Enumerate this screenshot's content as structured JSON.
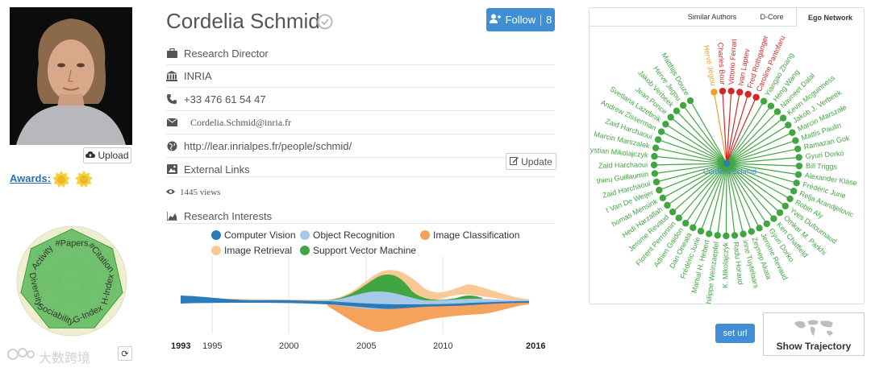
{
  "profile": {
    "name": "Cordelia Schmid",
    "upload_label": "Upload",
    "awards_label": "Awards:",
    "follow_label": "Follow",
    "follow_count": "8",
    "position": "Research Director",
    "affiliation": "INRIA",
    "phone": "+33 476 61 54 47",
    "email": "Cordelia.Schmid@inria.fr",
    "homepage": "http://lear.inrialpes.fr/people/schmid/",
    "external_links_label": "External Links",
    "update_label": "Update",
    "views": "1445 views",
    "research_interests_label": "Research Interests",
    "refresh_icon": "refresh-icon"
  },
  "radar": {
    "axes": [
      "#Papers",
      "#Citation",
      "H-Index",
      "G-Index",
      "Sociability",
      "Diversity",
      "Activity"
    ],
    "values": [
      0.95,
      0.95,
      0.95,
      0.95,
      0.95,
      0.95,
      0.95
    ],
    "fill": "#5cb85c"
  },
  "chart_data": {
    "type": "area",
    "title": "",
    "series": [
      {
        "name": "Computer Vision",
        "color": "#2b7bb9"
      },
      {
        "name": "Object Recognition",
        "color": "#a8c8e8"
      },
      {
        "name": "Image Classification",
        "color": "#f5a25d"
      },
      {
        "name": "Image Retrieval",
        "color": "#f9c995"
      },
      {
        "name": "Support Vector Machine",
        "color": "#41a541"
      }
    ],
    "x_start": "1993",
    "x_end": "2016",
    "xticks": [
      "1995",
      "2000",
      "2005",
      "2010"
    ],
    "grid": true
  },
  "ego": {
    "tabs": [
      "Similar Authors",
      "D-Core",
      "Ego Network"
    ],
    "active_tab": "Ego Network",
    "center": "Cordelia Schmid",
    "nodes": [
      {
        "name": "Hervé Jégou",
        "color": "#f0a030"
      },
      {
        "name": "Charles Bour",
        "color": "#d62728"
      },
      {
        "name": "Vittorio Ferrari",
        "color": "#d62728"
      },
      {
        "name": "Ivan Laptev",
        "color": "#d62728"
      },
      {
        "name": "Fred Rothganger",
        "color": "#d62728"
      },
      {
        "name": "Caroline Pantofaru",
        "color": "#d62728"
      },
      {
        "name": "Yiangao Zhang",
        "color": "#41a541"
      },
      {
        "name": "Heng Wang",
        "color": "#41a541"
      },
      {
        "name": "Navneet Dalal",
        "color": "#41a541"
      },
      {
        "name": "Kevin Mcguinness",
        "color": "#41a541"
      },
      {
        "name": "Jakob J. Verbeek",
        "color": "#41a541"
      },
      {
        "name": "Marcin Marszałe",
        "color": "#41a541"
      },
      {
        "name": "Mattis Paulin",
        "color": "#41a541"
      },
      {
        "name": "Ramazan Gok",
        "color": "#41a541"
      },
      {
        "name": "Gyuri Dorkó",
        "color": "#41a541"
      },
      {
        "name": "Bill Triggs",
        "color": "#41a541"
      },
      {
        "name": "Alexander Kläse",
        "color": "#41a541"
      },
      {
        "name": "Frédéric Jurie",
        "color": "#41a541"
      },
      {
        "name": "Relja Arandjelovic",
        "color": "#41a541"
      },
      {
        "name": "Robin Aly",
        "color": "#41a541"
      },
      {
        "name": "Yves Dufournaud",
        "color": "#41a541"
      },
      {
        "name": "Omkar M. Parkhi",
        "color": "#41a541"
      },
      {
        "name": "Ken Chatfield",
        "color": "#41a541"
      },
      {
        "name": "Gyuri Dorko",
        "color": "#41a541"
      },
      {
        "name": "Jerome Revaud",
        "color": "#41a541"
      },
      {
        "name": "Zeynep Akata",
        "color": "#41a541"
      },
      {
        "name": "inne Tuytelaars",
        "color": "#41a541"
      },
      {
        "name": "Radu Horaud",
        "color": "#41a541"
      },
      {
        "name": "K. Mikolajczyk",
        "color": "#41a541"
      },
      {
        "name": "hilippe Weinzaepfel",
        "color": "#41a541"
      },
      {
        "name": "Martial H. Hebert",
        "color": "#41a541"
      },
      {
        "name": "Frédéric Jurie",
        "color": "#41a541"
      },
      {
        "name": "Dan Oneata",
        "color": "#41a541"
      },
      {
        "name": "Adrien Gaidon",
        "color": "#41a541"
      },
      {
        "name": "Florent Perronnin",
        "color": "#41a541"
      },
      {
        "name": "Jerome Revaud",
        "color": "#41a541"
      },
      {
        "name": "Hedi Harzallah",
        "color": "#41a541"
      },
      {
        "name": "homas Mensink",
        "color": "#41a541"
      },
      {
        "name": "t Van De Weijer",
        "color": "#41a541"
      },
      {
        "name": "Zaid Harchaoui",
        "color": "#41a541"
      },
      {
        "name": "thieu Guillaumin",
        "color": "#41a541"
      },
      {
        "name": "Zaid Harchaoui",
        "color": "#41a541"
      },
      {
        "name": "ystian Mikolajczyk",
        "color": "#41a541"
      },
      {
        "name": "Marcin Marszalek",
        "color": "#41a541"
      },
      {
        "name": "Zaid Harchaoui",
        "color": "#41a541"
      },
      {
        "name": "Andrew Zisserman",
        "color": "#41a541"
      },
      {
        "name": "Svetlana Lazebnik",
        "color": "#41a541"
      },
      {
        "name": "Jean Ponce",
        "color": "#41a541"
      },
      {
        "name": "Jakob Verbeek",
        "color": "#41a541"
      },
      {
        "name": "Herve Jegou",
        "color": "#41a541"
      },
      {
        "name": "Matthijs Douze",
        "color": "#41a541"
      }
    ]
  },
  "actions": {
    "set_url_label": "set url",
    "show_trajectory_label": "Show Trajectory"
  },
  "watermark": "大数跨境",
  "colors": {
    "primary": "#3f8fd2",
    "link": "#2a6fb0",
    "network_green": "#41a541",
    "network_red": "#d62728",
    "network_orange": "#f0a030"
  }
}
